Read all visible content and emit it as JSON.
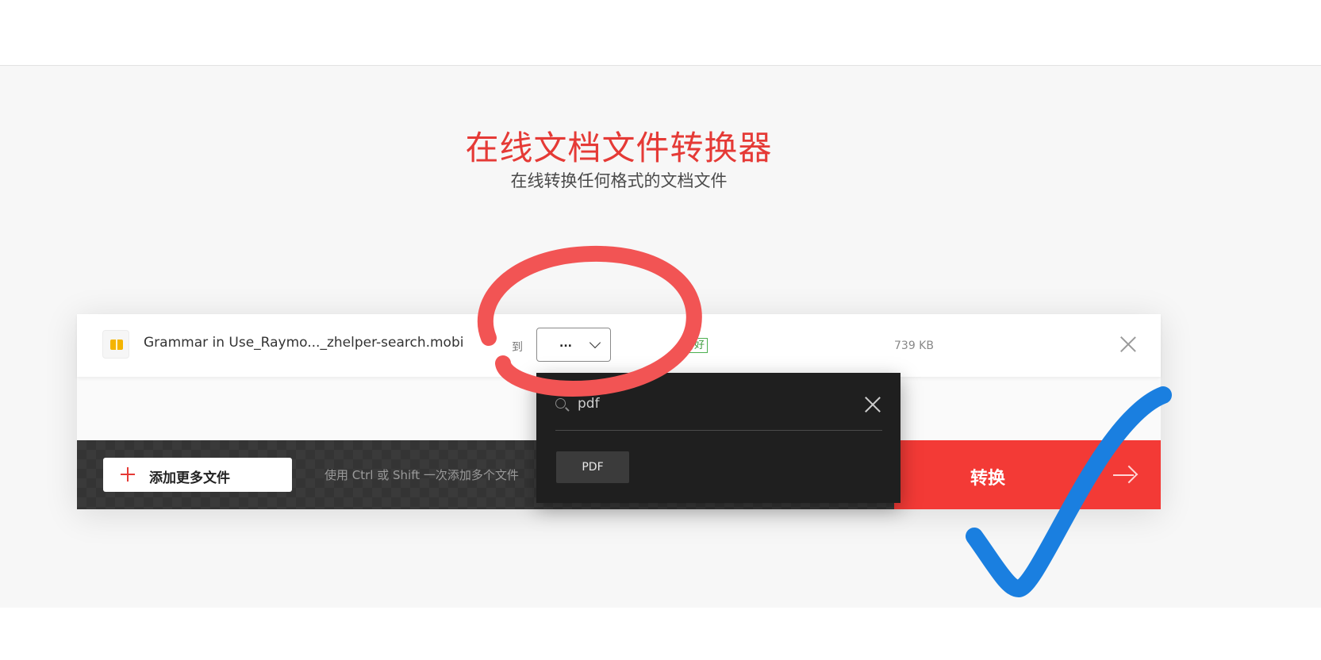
{
  "page": {
    "title": "在线文档文件转换器",
    "subtitle": "在线转换任何格式的文档文件"
  },
  "file_row": {
    "file_name": "Grammar in Use_Raymo..._zhelper-search.mobi",
    "to_label": "到",
    "format_value": "...",
    "status_badge": "备好",
    "file_size": "739 KB",
    "file_icon": "book-icon",
    "remove_icon": "close-icon"
  },
  "action_bar": {
    "add_more_label": "添加更多文件",
    "hint": "使用 Ctrl 或 Shift 一次添加多个文件",
    "convert_label": "转换",
    "convert_icon": "arrow-right-icon"
  },
  "format_dropdown": {
    "search_value": "pdf",
    "options": [
      "PDF"
    ],
    "search_icon": "search-icon",
    "clear_icon": "close-icon"
  },
  "colors": {
    "accent": "#e53a36",
    "convert_bg": "#f33a36",
    "dropdown_bg": "#1f1f1f",
    "annotation_circle": "#f25454",
    "annotation_check": "#1a7fe0"
  }
}
